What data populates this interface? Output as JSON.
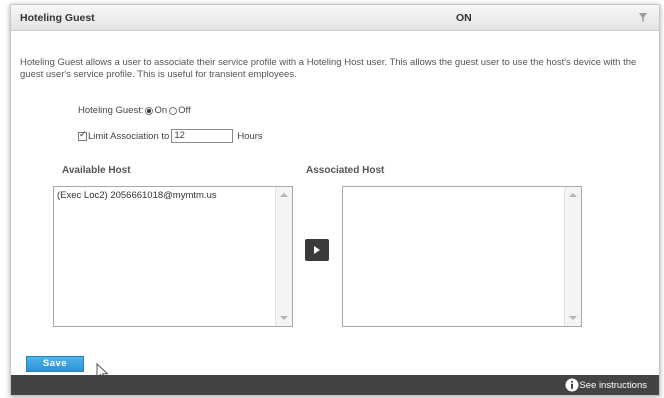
{
  "panel": {
    "title": "Hoteling Guest",
    "status": "ON",
    "collapse_icon": "funnel-arrow-icon"
  },
  "description": "Hoteling Guest allows a user to associate their service profile with a Hoteling Host user. This allows the guest user to use the host's device with the guest user's service profile. This is useful for transient employees.",
  "hoteling_guest": {
    "label": "Hoteling Guest:",
    "on_label": "On",
    "off_label": "Off",
    "selected": "On"
  },
  "limit": {
    "checked": true,
    "label": "Limit Association to",
    "value": "12",
    "unit": "Hours"
  },
  "available_host": {
    "label": "Available Host",
    "items": [
      "(Exec Loc2) 2056661018@mymtm.us"
    ]
  },
  "associated_host": {
    "label": "Associated Host",
    "items": []
  },
  "move_button_icon": "arrow-right-icon",
  "save_label": "Save",
  "footer": {
    "instructions_label": "See instructions",
    "info_icon": "info-icon"
  }
}
